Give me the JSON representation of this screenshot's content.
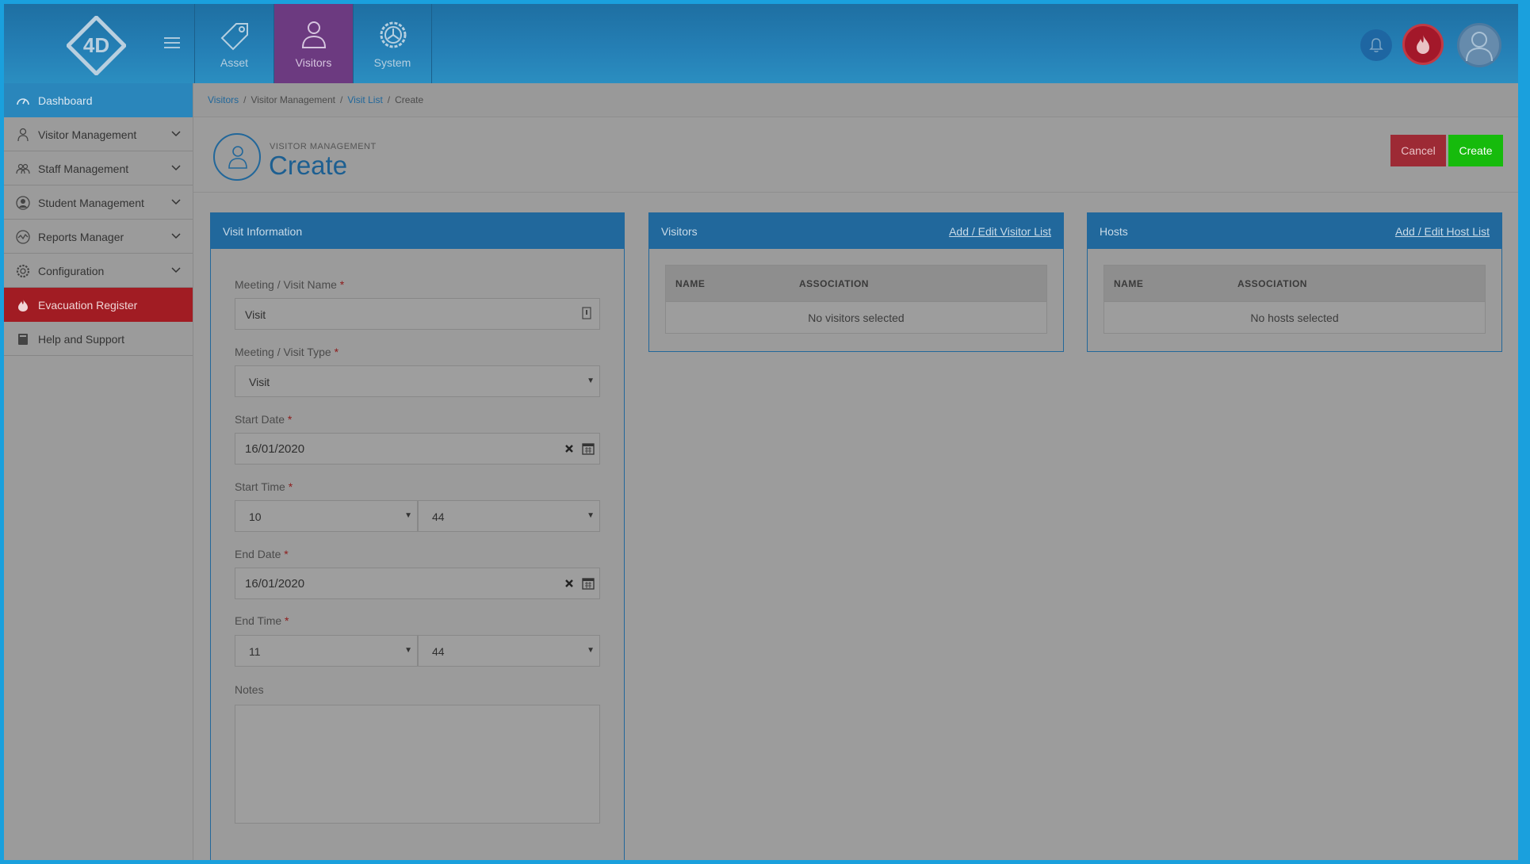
{
  "topnav": {
    "tabs": [
      {
        "label": "Asset",
        "icon": "tag-icon"
      },
      {
        "label": "Visitors",
        "icon": "person-icon"
      },
      {
        "label": "System",
        "icon": "gear-icon"
      }
    ]
  },
  "sidebar": {
    "items": [
      {
        "label": "Dashboard",
        "icon": "speedometer-icon"
      },
      {
        "label": "Visitor Management",
        "icon": "person-icon"
      },
      {
        "label": "Staff Management",
        "icon": "group-icon"
      },
      {
        "label": "Student Management",
        "icon": "student-icon"
      },
      {
        "label": "Reports Manager",
        "icon": "chart-icon"
      },
      {
        "label": "Configuration",
        "icon": "gear-icon"
      },
      {
        "label": "Evacuation Register",
        "icon": "flame-icon"
      },
      {
        "label": "Help and Support",
        "icon": "book-icon"
      }
    ]
  },
  "breadcrumb": {
    "items": [
      "Visitors",
      "Visitor Management",
      "Visit List",
      "Create"
    ]
  },
  "page": {
    "subtitle": "VISITOR MANAGEMENT",
    "title": "Create",
    "cancel_label": "Cancel",
    "create_label": "Create"
  },
  "visit_panel": {
    "title": "Visit Information",
    "name_label": "Meeting / Visit Name",
    "name_value": "Visit",
    "type_label": "Meeting / Visit Type",
    "type_value": "Visit",
    "start_date_label": "Start Date",
    "start_date_value": "16/01/2020",
    "start_time_label": "Start Time",
    "start_hour": "10",
    "start_minute": "44",
    "end_date_label": "End Date",
    "end_date_value": "16/01/2020",
    "end_time_label": "End Time",
    "end_hour": "11",
    "end_minute": "44",
    "notes_label": "Notes",
    "required_mark": "*"
  },
  "visitors_panel": {
    "title": "Visitors",
    "link": "Add / Edit Visitor List",
    "col_name": "NAME",
    "col_assoc": "ASSOCIATION",
    "empty": "No visitors selected"
  },
  "hosts_panel": {
    "title": "Hosts",
    "link": "Add / Edit Host List",
    "col_name": "NAME",
    "col_assoc": "ASSOCIATION",
    "empty": "No hosts selected"
  }
}
